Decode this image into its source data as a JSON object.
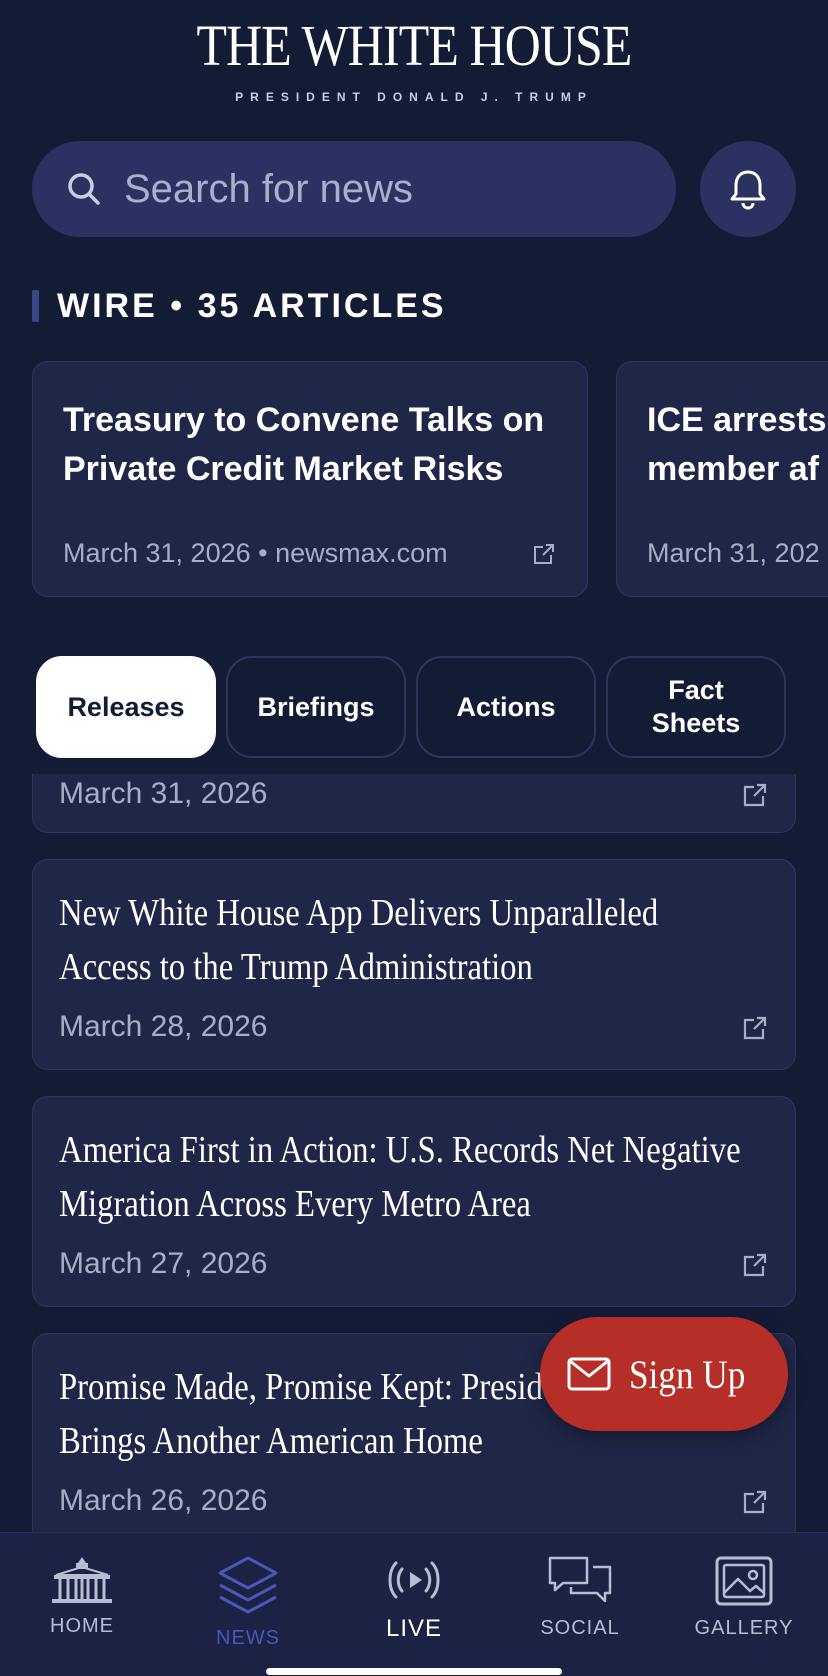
{
  "header": {
    "title": "THE WHITE HOUSE",
    "subtitle": "PRESIDENT DONALD J. TRUMP"
  },
  "search": {
    "placeholder": "Search for news",
    "icon": "search-icon"
  },
  "notifications": {
    "icon": "bell-icon"
  },
  "wire": {
    "title": "WIRE • 35 ARTICLES",
    "cards": [
      {
        "title_line1": "Treasury to Convene Talks on",
        "title_line2": "Private Credit Market Risks",
        "meta": "March 31, 2026 • newsmax.com"
      },
      {
        "title_line1": "ICE arrests",
        "title_line2": "member af",
        "meta": "March 31, 202"
      }
    ]
  },
  "tabs": [
    {
      "label": "Releases",
      "active": true
    },
    {
      "label": "Briefings",
      "active": false
    },
    {
      "label": "Actions",
      "active": false
    },
    {
      "label": "Fact Sheets",
      "active": false
    }
  ],
  "releases": [
    {
      "title_line1": "",
      "title_line2": "",
      "date": "March 31, 2026"
    },
    {
      "title_line1": "New White House App Delivers Unparalleled",
      "title_line2": "Access to the Trump Administration",
      "date": "March 28, 2026"
    },
    {
      "title_line1": "America First in Action: U.S. Records Net Negative",
      "title_line2": "Migration Across Every Metro Area",
      "date": "March 27, 2026"
    },
    {
      "title_line1": "Promise Made, Promise Kept: Preside",
      "title_line2": "Brings Another American Home",
      "date": "March 26, 2026"
    }
  ],
  "signup": {
    "label": "Sign Up",
    "icon": "envelope-icon"
  },
  "bottom_nav": [
    {
      "label": "HOME",
      "icon": "white-house-icon",
      "active": false
    },
    {
      "label": "NEWS",
      "icon": "layers-icon",
      "active": true
    },
    {
      "label": "LIVE",
      "icon": "live-broadcast-icon",
      "active": false
    },
    {
      "label": "SOCIAL",
      "icon": "chat-bubbles-icon",
      "active": false
    },
    {
      "label": "GALLERY",
      "icon": "gallery-icon",
      "active": false
    }
  ],
  "colors": {
    "background": "#141b35",
    "card": "#1f2648",
    "search_bg": "#2b3262",
    "signup": "#b52e27",
    "nav_active": "#4a56b8"
  }
}
